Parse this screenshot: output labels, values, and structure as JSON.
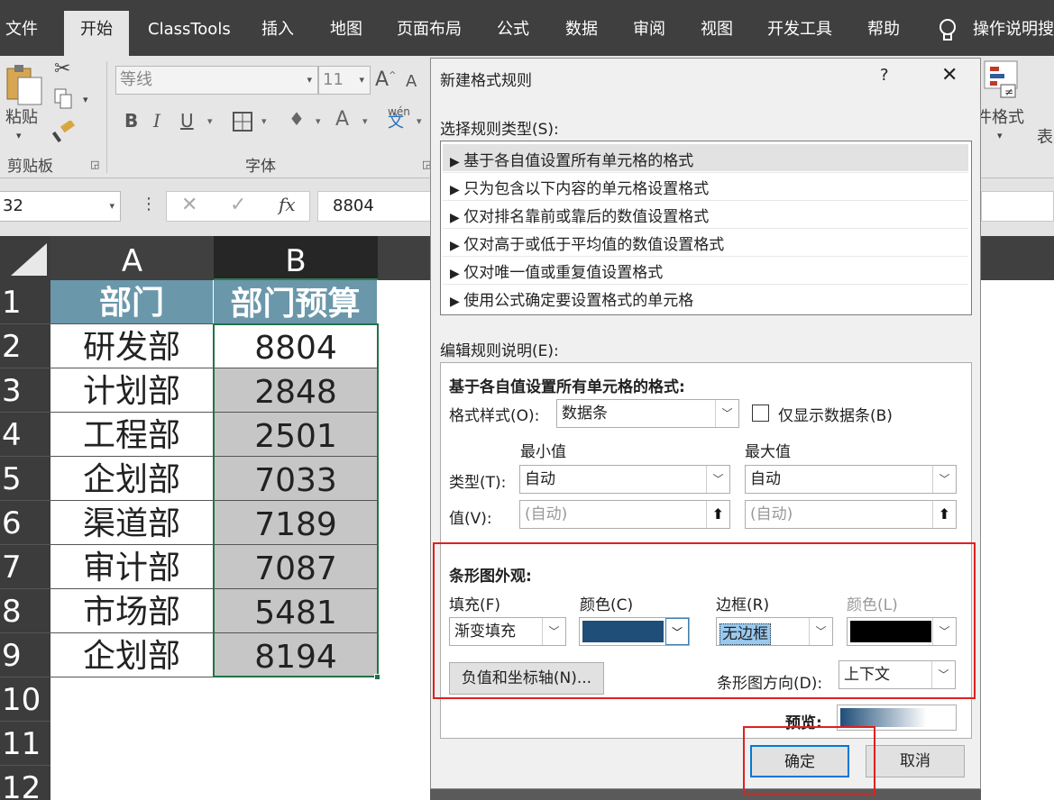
{
  "ribbon_tabs": [
    "文件",
    "开始",
    "ClassTools",
    "插入",
    "地图",
    "页面布局",
    "公式",
    "数据",
    "审阅",
    "视图",
    "开发工具",
    "帮助",
    "操作说明搜"
  ],
  "ribbon": {
    "paste_label": "粘贴",
    "clipboard_group": "剪贴板",
    "font_group": "字体",
    "font_name": "等线",
    "font_size": "11",
    "conditional_format_label": "件格式",
    "table_label": "表"
  },
  "formula_bar": {
    "name_box": "32",
    "fx": "fx",
    "value": "8804"
  },
  "sheet": {
    "columns": [
      "A",
      "B"
    ],
    "headers": [
      "部门",
      "部门预算"
    ],
    "rows": [
      {
        "n": "1"
      },
      {
        "n": "2",
        "a": "研发部",
        "b": "8804"
      },
      {
        "n": "3",
        "a": "计划部",
        "b": "2848"
      },
      {
        "n": "4",
        "a": "工程部",
        "b": "2501"
      },
      {
        "n": "5",
        "a": "企划部",
        "b": "7033"
      },
      {
        "n": "6",
        "a": "渠道部",
        "b": "7189"
      },
      {
        "n": "7",
        "a": "审计部",
        "b": "7087"
      },
      {
        "n": "8",
        "a": "市场部",
        "b": "5481"
      },
      {
        "n": "9",
        "a": "企划部",
        "b": "8194"
      },
      {
        "n": "10"
      },
      {
        "n": "11"
      },
      {
        "n": "12"
      }
    ]
  },
  "dialog": {
    "title": "新建格式规则",
    "help": "?",
    "close": "✕",
    "select_rule_type": "选择规则类型(S):",
    "rule_types": [
      "基于各自值设置所有单元格的格式",
      "只为包含以下内容的单元格设置格式",
      "仅对排名靠前或靠后的数值设置格式",
      "仅对高于或低于平均值的数值设置格式",
      "仅对唯一值或重复值设置格式",
      "使用公式确定要设置格式的单元格"
    ],
    "edit_rule_desc": "编辑规则说明(E):",
    "desc_heading": "基于各自值设置所有单元格的格式:",
    "format_style_label": "格式样式(O):",
    "format_style_value": "数据条",
    "show_bar_only": "仅显示数据条(B)",
    "min_label": "最小值",
    "max_label": "最大值",
    "type_label": "类型(T):",
    "min_type": "自动",
    "max_type": "自动",
    "value_label": "值(V):",
    "min_value_placeholder": "(自动)",
    "max_value_placeholder": "(自动)",
    "bar_appearance": "条形图外观:",
    "fill_label": "填充(F)",
    "fill_value": "渐变填充",
    "color_label": "颜色(C)",
    "fill_color": "#1f4e79",
    "border_label": "边框(R)",
    "border_value": "无边框",
    "border_color_label": "颜色(L)",
    "border_color": "#000000",
    "negative_axis_button": "负值和坐标轴(N)...",
    "bar_direction_label": "条形图方向(D):",
    "bar_direction_value": "上下文",
    "preview_label": "预览:",
    "ok_button": "确定",
    "cancel_button": "取消"
  },
  "colors": {
    "header_fill": "#6a97aa",
    "highlight_red": "#e0201f"
  }
}
